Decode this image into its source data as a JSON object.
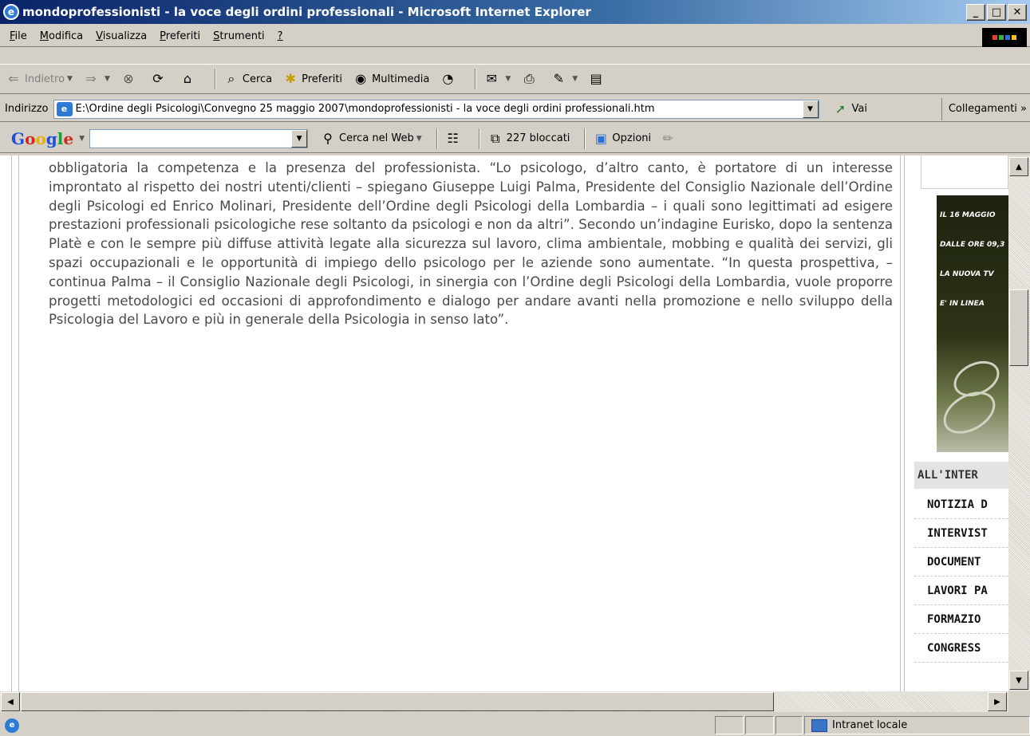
{
  "window": {
    "title": "mondoprofessionisti - la voce degli ordini professionali - Microsoft Internet Explorer",
    "buttons": {
      "minimize": "_",
      "maximize": "□",
      "close": "✕"
    }
  },
  "menu": [
    {
      "label": "File",
      "key": "F",
      "rest": "ile"
    },
    {
      "label": "Modifica",
      "key": "M",
      "rest": "odifica"
    },
    {
      "label": "Visualizza",
      "key": "V",
      "rest": "isualizza"
    },
    {
      "label": "Preferiti",
      "key": "P",
      "rest": "referiti"
    },
    {
      "label": "Strumenti",
      "key": "S",
      "rest": "trumenti"
    },
    {
      "label": "?",
      "key": "?",
      "rest": ""
    }
  ],
  "toolbar": {
    "back_label": "Indietro",
    "search_label": "Cerca",
    "favorites_label": "Preferiti",
    "multimedia_label": "Multimedia"
  },
  "address": {
    "label": "Indirizzo",
    "url": "E:\\Ordine degli Psicologi\\Convegno 25 maggio 2007\\mondoprofessionisti - la voce degli ordini professionali.htm",
    "go_label": "Vai",
    "links_label": "Collegamenti »"
  },
  "google_toolbar": {
    "search_value": "",
    "search_web_label": "Cerca nel Web",
    "blocked_label": "227 bloccati",
    "options_label": "Opzioni"
  },
  "article": {
    "text": "obbligatoria la competenza e la presenza del professionista. “Lo psicologo, d’altro canto, è portatore di un interesse improntato al rispetto dei nostri utenti/clienti – spiegano Giuseppe Luigi Palma, Presidente del Consiglio Nazionale dell’Ordine degli Psicologi ed Enrico Molinari, Presidente dell’Ordine degli Psicologi della Lombardia – i quali sono legittimati ad esigere prestazioni professionali psicologiche rese soltanto da psicologi e non da altri”. Secondo un’indagine Eurisko, dopo la sentenza Platè e con le sempre più diffuse attività legate alla sicurezza sul lavoro, clima ambientale, mobbing e qualità dei servizi, gli spazi occupazionali e le opportunità di impiego dello psicologo per le aziende sono aumentate. “In questa prospettiva, – continua Palma – il Consiglio Nazionale degli Psicologi, in sinergia con l’Ordine degli Psicologi della Lombardia, vuole proporre progetti metodologici ed occasioni di approfondimento e dialogo per andare avanti nella promozione e nello sviluppo della Psicologia del Lavoro e più in generale della Psicologia in senso lato”."
  },
  "sidebar": {
    "banner_lines": [
      "IL 16 MAGGIO",
      "DALLE ORE 09,3",
      "LA NUOVA TV",
      "E' IN LINEA"
    ],
    "heading": "ALL'INTER",
    "items": [
      "NOTIZIA D",
      "INTERVIST",
      "DOCUMENT",
      "LAVORI PA",
      "FORMAZIO",
      "CONGRESS"
    ]
  },
  "status": {
    "zone_label": "Intranet locale"
  }
}
